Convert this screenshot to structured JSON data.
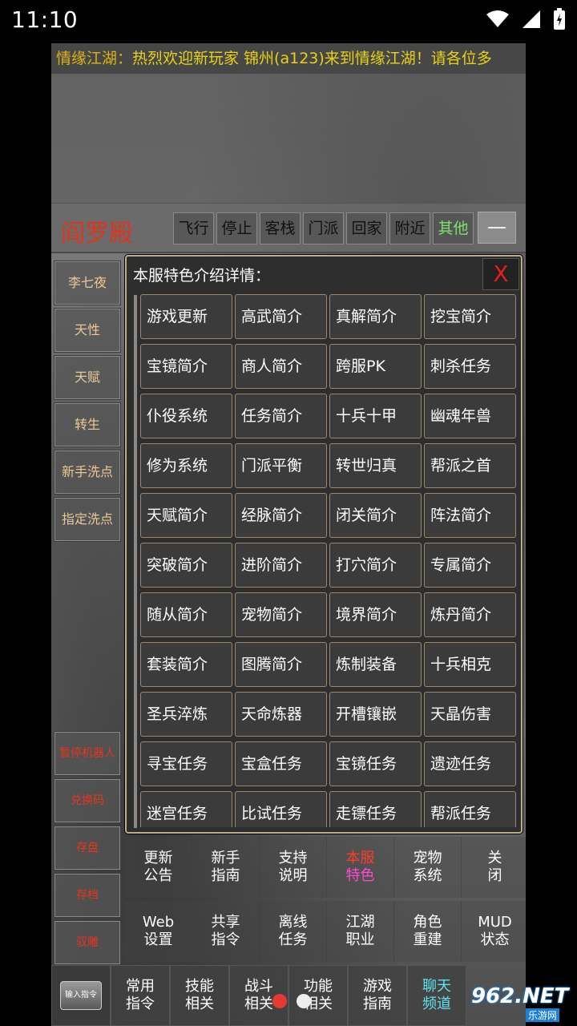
{
  "status_bar": {
    "time": "11:10"
  },
  "ticker": {
    "label": "情缘江湖：",
    "text": "热烈欢迎新玩家 锦州(a123)来到情缘江湖！请各位多"
  },
  "location": {
    "title": "阎罗殿",
    "buttons": [
      "飞行",
      "停止",
      "客栈",
      "门派",
      "回家",
      "附近",
      "其他"
    ],
    "minimize": "—"
  },
  "side_buttons": [
    "李七夜",
    "天性",
    "天赋",
    "转生",
    "新手洗点",
    "指定洗点"
  ],
  "side_buttons_lower": [
    "暂停机器人",
    "兑换码",
    "存盘",
    "存档",
    "驭雕"
  ],
  "modal": {
    "title": "本服特色介绍详情：",
    "close": "X",
    "items": [
      "游戏更新",
      "高武简介",
      "真解简介",
      "挖宝简介",
      "宝镜简介",
      "商人简介",
      "跨服PK",
      "刺杀任务",
      "仆役系统",
      "任务简介",
      "十兵十甲",
      "幽魂年兽",
      "修为系统",
      "门派平衡",
      "转世归真",
      "帮派之首",
      "天赋简介",
      "经脉简介",
      "闭关简介",
      "阵法简介",
      "突破简介",
      "进阶简介",
      "打穴简介",
      "专属简介",
      "随从简介",
      "宠物简介",
      "境界简介",
      "炼丹简介",
      "套装简介",
      "图腾简介",
      "炼制装备",
      "十兵相克",
      "圣兵淬炼",
      "天命炼器",
      "开槽镶嵌",
      "天晶伤害",
      "寻宝任务",
      "宝盒任务",
      "宝镜任务",
      "遗迹任务",
      "迷宫任务",
      "比试任务",
      "走镖任务",
      "帮派任务"
    ]
  },
  "menu_row1": [
    {
      "l1": "更新",
      "l2": "公告"
    },
    {
      "l1": "新手",
      "l2": "指南"
    },
    {
      "l1": "支持",
      "l2": "说明"
    },
    {
      "l1": "本服",
      "l2": "特色"
    },
    {
      "l1": "宠物",
      "l2": "系统"
    },
    {
      "l1": "关",
      "l2": "闭"
    }
  ],
  "menu_row2": [
    {
      "l1": "Web",
      "l2": "设置"
    },
    {
      "l1": "共享",
      "l2": "指令"
    },
    {
      "l1": "离线",
      "l2": "任务"
    },
    {
      "l1": "江湖",
      "l2": "职业"
    },
    {
      "l1": "角色",
      "l2": "重建"
    },
    {
      "l1": "MUD",
      "l2": "状态"
    }
  ],
  "bottom_bar": {
    "cmd_chip": "输入指令",
    "items": [
      {
        "l1": "常用",
        "l2": "指令"
      },
      {
        "l1": "技能",
        "l2": "相关"
      },
      {
        "l1": "战斗",
        "l2": "相关"
      },
      {
        "l1": "功能",
        "l2": "相关"
      },
      {
        "l1": "游戏",
        "l2": "指南"
      },
      {
        "l1": "聊天",
        "l2": "频道"
      }
    ]
  },
  "watermark": {
    "main": "962.NET",
    "sub": "乐游网"
  },
  "colors": {
    "accent_red": "#e0341c",
    "ticker_yellow": "#e9d212",
    "cell_border": "#9d8770"
  }
}
